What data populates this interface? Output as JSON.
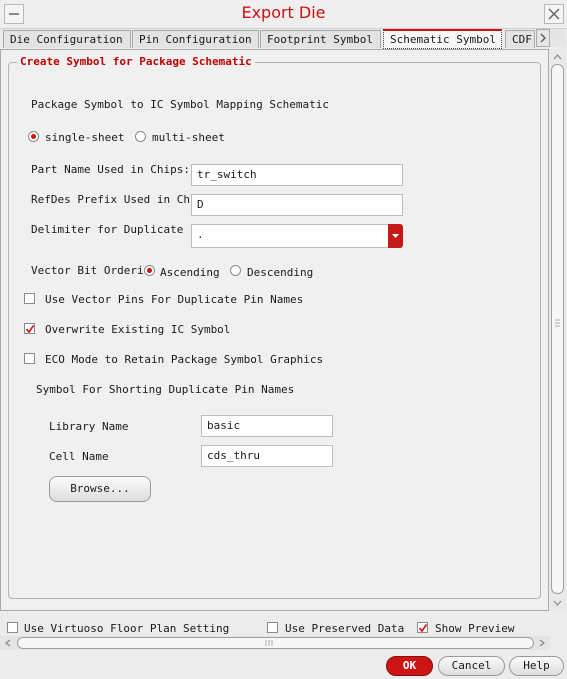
{
  "window": {
    "title": "Export Die"
  },
  "tabs": [
    {
      "label": "Die Configuration"
    },
    {
      "label": "Pin Configuration"
    },
    {
      "label": "Footprint Symbol"
    },
    {
      "label": "Schematic Symbol"
    },
    {
      "label": "CDF"
    }
  ],
  "group": {
    "title": "Create Symbol for Package Schematic",
    "mapping_label": "Package Symbol to IC Symbol Mapping Schematic",
    "mapping_options": [
      {
        "label": "single-sheet",
        "selected": true
      },
      {
        "label": "multi-sheet",
        "selected": false
      }
    ],
    "part_name": {
      "label": "Part Name Used in Chips:",
      "value": "tr_switch"
    },
    "refdes": {
      "label": "RefDes Prefix Used in Ch",
      "value": "D"
    },
    "delimiter": {
      "label": "Delimiter for Duplicate P",
      "value": "."
    },
    "vector_order": {
      "label": "Vector Bit Orderi",
      "options": [
        {
          "label": "Ascending",
          "selected": true
        },
        {
          "label": "Descending",
          "selected": false
        }
      ]
    },
    "checks": [
      {
        "label": "Use Vector Pins For Duplicate Pin Names",
        "checked": false
      },
      {
        "label": "Overwrite Existing IC Symbol",
        "checked": true
      },
      {
        "label": "ECO Mode to Retain Package Symbol Graphics",
        "checked": false
      }
    ],
    "shorting_label": "Symbol For Shorting Duplicate Pin Names",
    "library": {
      "label": "Library Name",
      "value": "basic"
    },
    "cell": {
      "label": "Cell Name",
      "value": "cds_thru"
    },
    "browse_label": "Browse..."
  },
  "bottom_checks": [
    {
      "label": "Use Virtuoso Floor Plan Setting",
      "checked": false
    },
    {
      "label": "Use Preserved Data",
      "checked": false
    },
    {
      "label": "Show Preview",
      "checked": true
    }
  ],
  "footer": {
    "ok": "OK",
    "cancel": "Cancel",
    "help": "Help"
  },
  "icons": {
    "minimize": "minimize-icon",
    "close": "close-icon",
    "tab_scroll": "chevron-right-icon",
    "dropdown": "chevron-down-icon"
  },
  "colors": {
    "accent": "#d01010",
    "background": "#ececec"
  }
}
